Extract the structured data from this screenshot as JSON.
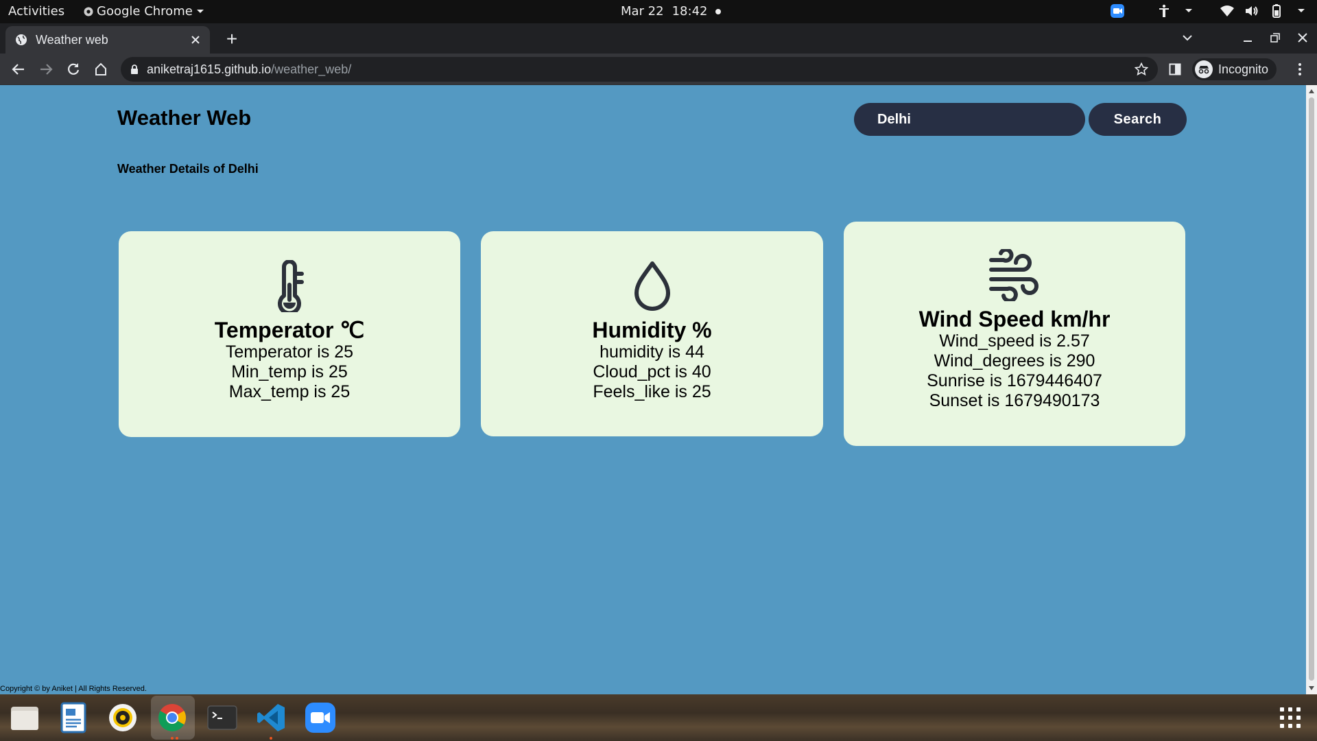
{
  "system": {
    "activities_label": "Activities",
    "app_name": "Google Chrome",
    "date": "Mar 22",
    "time": "18:42"
  },
  "browser": {
    "tab_title": "Weather web",
    "url_host": "aniketraj1615.github.io",
    "url_path": "/weather_web/",
    "profile_label": "Incognito"
  },
  "page": {
    "site_title": "Weather Web",
    "search": {
      "value": "Delhi",
      "button_label": "Search"
    },
    "details_heading": "Weather Details of Delhi",
    "cards": {
      "temperature": {
        "icon": "thermometer-icon",
        "title": "Temperator ℃",
        "lines": [
          "Temperator is 25",
          "Min_temp is 25",
          "Max_temp is 25"
        ]
      },
      "humidity": {
        "icon": "water-drop-icon",
        "title": "Humidity %",
        "lines": [
          "humidity is 44",
          "Cloud_pct is 40",
          "Feels_like is 25"
        ]
      },
      "wind": {
        "icon": "wind-icon",
        "title": "Wind Speed km/hr",
        "lines": [
          "Wind_speed is 2.57",
          "Wind_degrees is 290",
          "Sunrise is 1679446407",
          "Sunset is 1679490173"
        ]
      }
    },
    "footer": "Copyright © by Aniket | All Rights Reserved."
  },
  "colors": {
    "page_background": "#5499c2",
    "card_background": "#e9f7e1",
    "control_background": "#272f44"
  },
  "dock": {
    "items": [
      "files-icon",
      "text-editor-icon",
      "rhythmbox-icon",
      "chrome-icon",
      "terminal-icon",
      "vscode-icon",
      "zoom-icon"
    ]
  }
}
